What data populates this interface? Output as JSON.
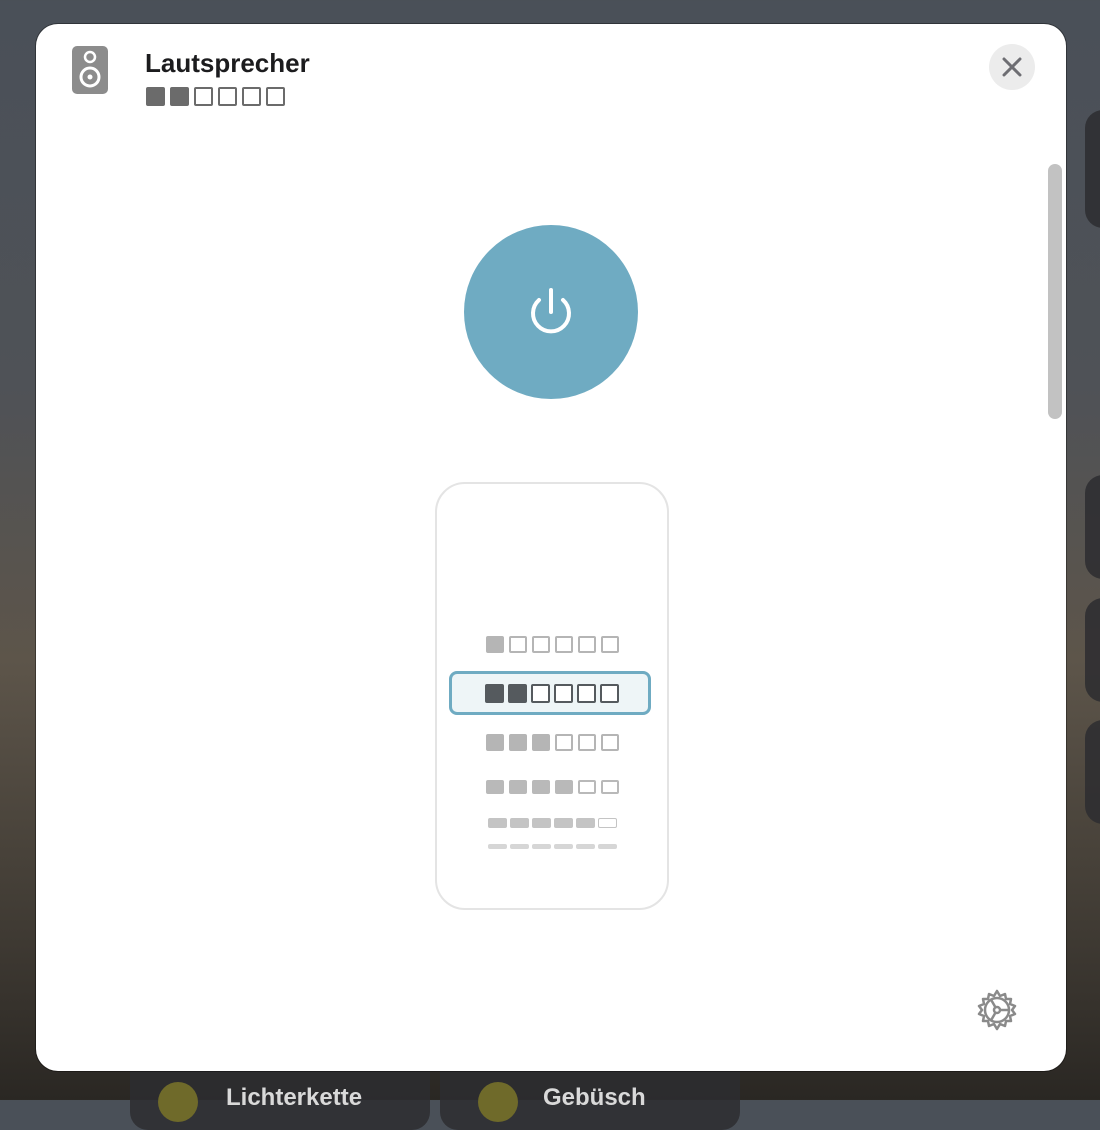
{
  "dialog": {
    "title": "Lautsprecher",
    "current_level": 2,
    "max_level": 6,
    "power_color": "#6fabc2",
    "icons": {
      "device": "speaker-icon",
      "close": "close-icon",
      "power": "power-icon",
      "settings": "gear-icon"
    }
  },
  "background": {
    "tiles": [
      "Lichterkette",
      "Gebüsch"
    ]
  },
  "volume_picker": {
    "levels": [
      1,
      2,
      3,
      4,
      5,
      6
    ],
    "selected": 2,
    "segments": 6
  }
}
